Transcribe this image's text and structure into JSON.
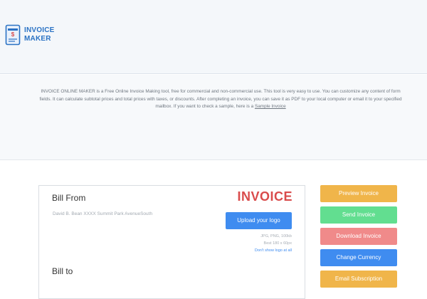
{
  "brand": {
    "line1": "INVOICE",
    "line2": "MAKER",
    "accent": "#2a72c4",
    "icon": "invoice-document-dollar-icon"
  },
  "intro": {
    "text": "INVOICE ONLINE MAKER is a Free Online Invoice Making tool, free for commercial and non-commercial use. This tool is very easy to use. You can customize any content of form fields. It can calculate subtotal prices and total prices with taxes, or discounts. After completing an invoice, you can save it as PDF to your local computer or email it to your specified mailbox. If you want to check a sample, here is a",
    "link_label": "Sample Invoice"
  },
  "invoice": {
    "bill_from_label": "Bill From",
    "from_address": "David B. Bean XXXX Summit Park AvenueSouth",
    "title": "INVOICE",
    "title_color": "#d94c4c",
    "upload_label": "Upload your logo",
    "logo_formats": "JPG, PNG, 100kb",
    "logo_size": "Best 180 x 60px",
    "no_logo_label": "Don't show logo at all",
    "bill_to_label": "Bill to"
  },
  "actions": {
    "preview": "Preview Invoice",
    "send": "Send Invoice",
    "download": "Download Invoice",
    "currency": "Change Currency",
    "subscription": "Email Subscription"
  }
}
